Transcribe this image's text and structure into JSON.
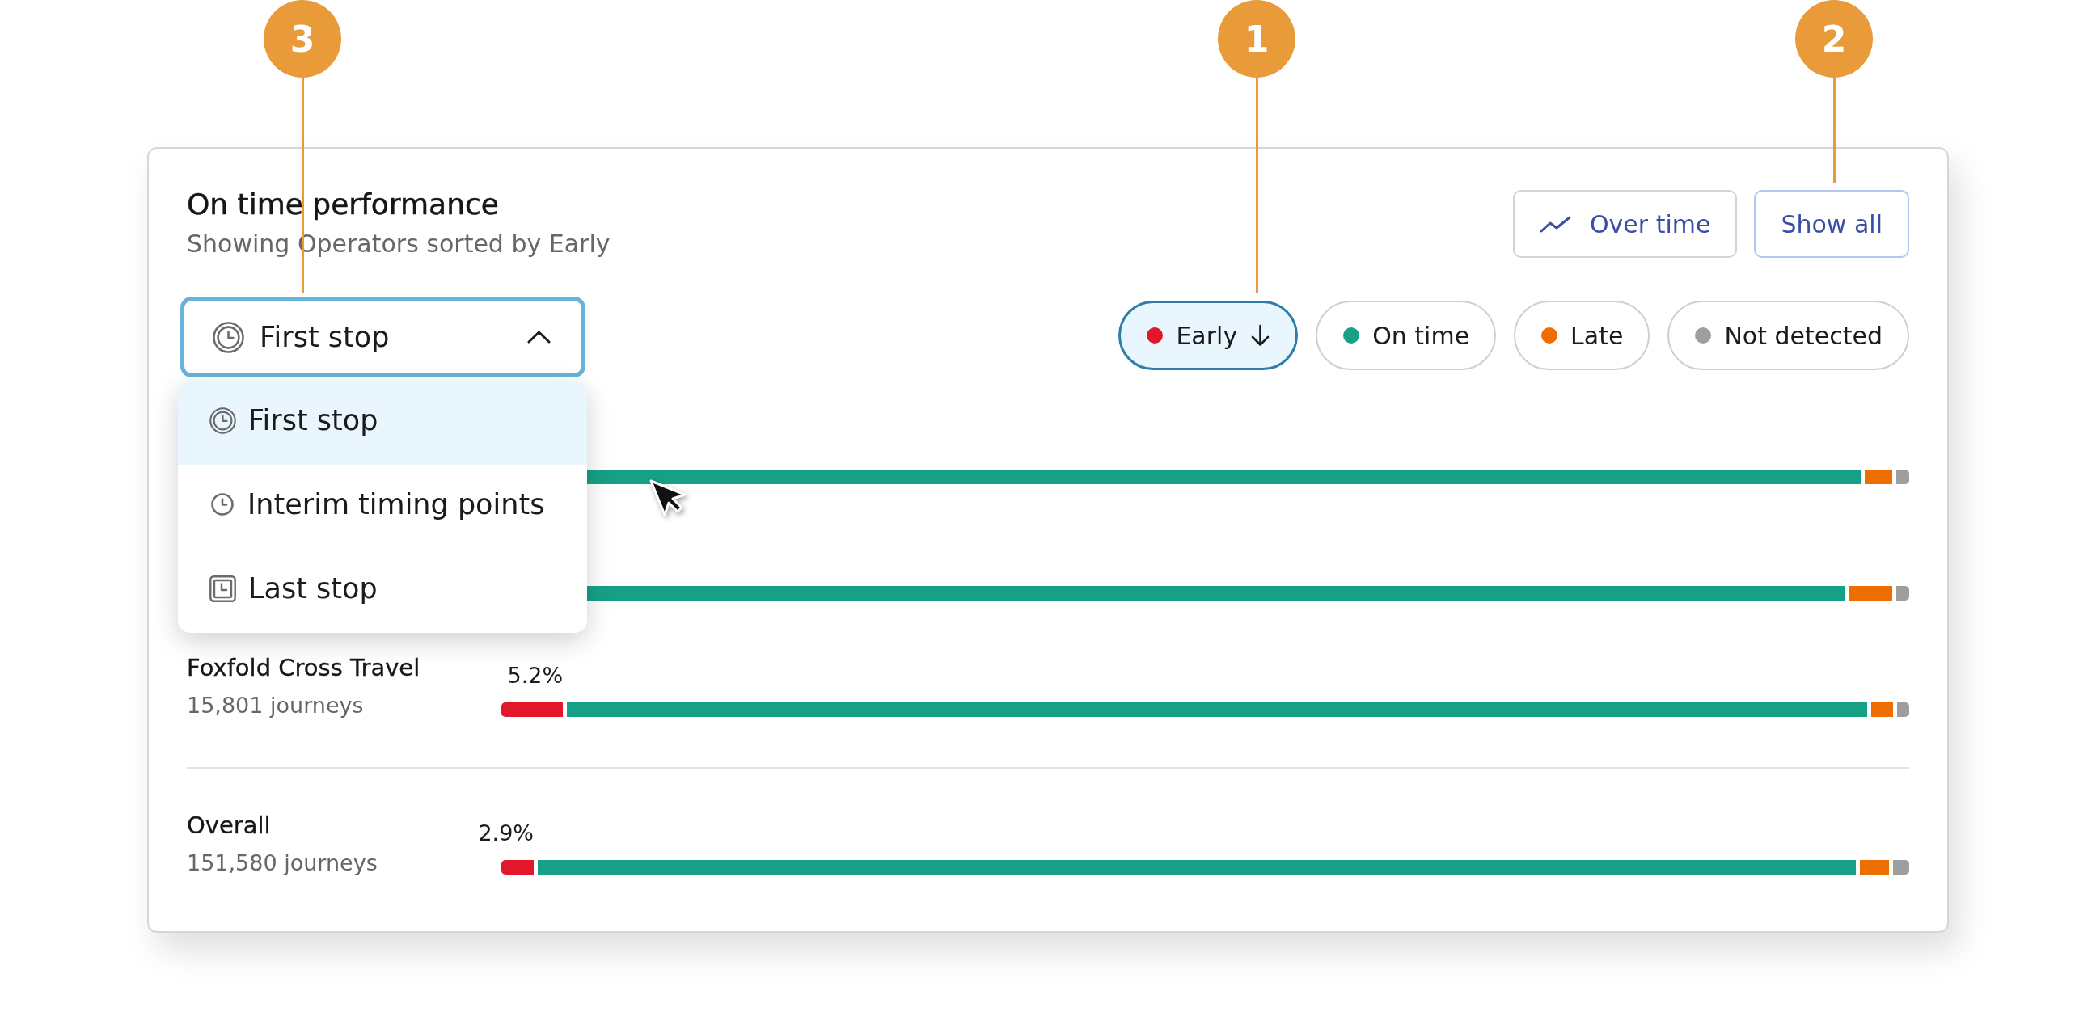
{
  "callouts": [
    {
      "number": "3"
    },
    {
      "number": "1"
    },
    {
      "number": "2"
    }
  ],
  "card": {
    "title": "On time performance",
    "subtitle": "Showing Operators sorted by Early",
    "buttons": [
      {
        "label": "Over time",
        "kind": "icon",
        "focused": false
      },
      {
        "label": "Show all",
        "kind": "text",
        "focused": true
      }
    ],
    "stop_select": {
      "value": "First stop",
      "kind": "first",
      "expanded": true,
      "options": [
        {
          "label": "First stop",
          "kind": "first",
          "selected": true
        },
        {
          "label": "Interim timing points",
          "kind": "interim",
          "selected": false
        },
        {
          "label": "Last stop",
          "kind": "last",
          "selected": false
        }
      ]
    },
    "filters": [
      {
        "label": "Early",
        "color": "#e3172b",
        "selected": true,
        "sorted": true
      },
      {
        "label": "On time",
        "color": "#17a086",
        "selected": false,
        "sorted": false
      },
      {
        "label": "Late",
        "color": "#ec6e00",
        "selected": false,
        "sorted": false
      },
      {
        "label": "Not detected",
        "color": "#9e9e9e",
        "selected": false,
        "sorted": false
      }
    ],
    "rows": [
      {
        "segments": [
          {
            "color": "#17a086"
          },
          {
            "color": "#ec6e00"
          },
          {
            "color": "#9e9e9e"
          }
        ]
      },
      {
        "segments": [
          {
            "color": "#17a086"
          },
          {
            "color": "#ec6e00"
          },
          {
            "color": "#9e9e9e"
          }
        ]
      },
      {
        "name": "Foxfold Cross Travel",
        "journeys": "15,801 journeys",
        "percent": "5.2%",
        "segments": [
          {
            "color": "#e3172b"
          },
          {
            "color": "#17a086"
          },
          {
            "color": "#ec6e00"
          },
          {
            "color": "#9e9e9e"
          }
        ]
      }
    ],
    "overall": {
      "name": "Overall",
      "journeys": "151,580 journeys",
      "percent": "2.9%",
      "segments": [
        {
          "color": "#e3172b"
        },
        {
          "color": "#17a086"
        },
        {
          "color": "#ec6e00"
        },
        {
          "color": "#9e9e9e"
        }
      ]
    }
  }
}
